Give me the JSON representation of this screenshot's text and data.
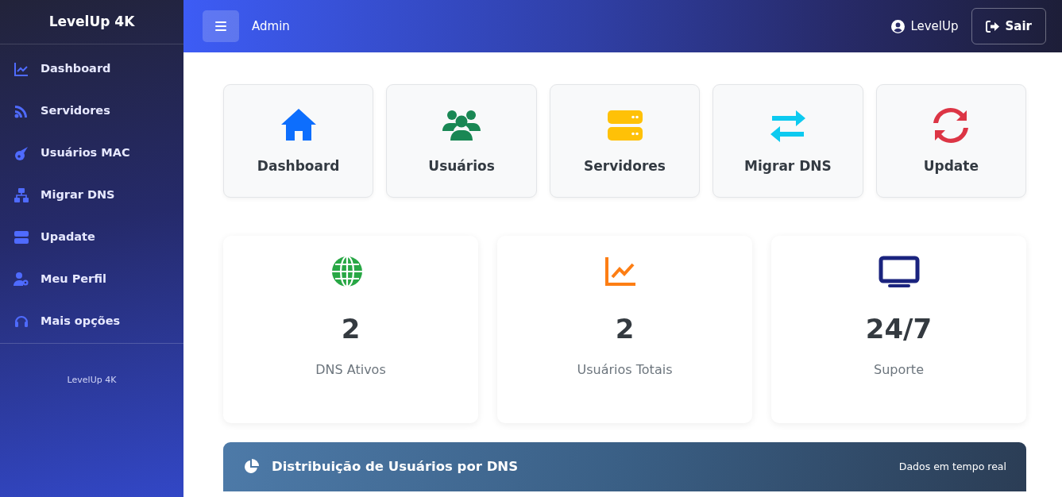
{
  "sidebar": {
    "brand": "LevelUp 4K",
    "items": [
      {
        "label": "Dashboard"
      },
      {
        "label": "Servidores"
      },
      {
        "label": "Usuários MAC"
      },
      {
        "label": "Migrar DNS"
      },
      {
        "label": "Upadate"
      },
      {
        "label": "Meu Perfil"
      },
      {
        "label": "Mais opções"
      }
    ],
    "footer": "LevelUp 4K"
  },
  "header": {
    "page": "Admin",
    "user": "LevelUp",
    "logout": "Sair"
  },
  "shortcuts": [
    {
      "label": "Dashboard",
      "color": "#0d6efd"
    },
    {
      "label": "Usuários",
      "color": "#198754"
    },
    {
      "label": "Servidores",
      "color": "#ffc107"
    },
    {
      "label": "Migrar DNS",
      "color": "#0dcaf0"
    },
    {
      "label": "Update",
      "color": "#dc3545"
    }
  ],
  "stats": [
    {
      "value": "2",
      "label": "DNS Ativos",
      "color": "#28a745"
    },
    {
      "value": "2",
      "label": "Usuários Totais",
      "color": "#fd7e14"
    },
    {
      "value": "24/7",
      "label": "Suporte",
      "color": "#1a237e"
    }
  ],
  "chart_panel": {
    "title": "Distribuição de Usuários por DNS",
    "note": "Dados em tempo real"
  }
}
